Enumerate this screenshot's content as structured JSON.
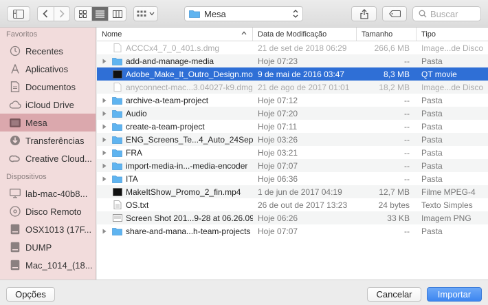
{
  "toolbar": {
    "location": "Mesa",
    "search_placeholder": "Buscar"
  },
  "colors": {
    "accent": "#2f6fd6",
    "sidebar_bg": "#f2dcdc",
    "sidebar_selected": "#dba8ad",
    "folder_blue": "#5fb4f0",
    "primary_button": "#3d86f0"
  },
  "sidebar": {
    "favorites_label": "Favoritos",
    "favorites": [
      {
        "label": "Recentes",
        "icon": "clock-icon"
      },
      {
        "label": "Aplicativos",
        "icon": "applications-icon"
      },
      {
        "label": "Documentos",
        "icon": "document-icon"
      },
      {
        "label": "iCloud Drive",
        "icon": "cloud-icon"
      },
      {
        "label": "Mesa",
        "icon": "desktop-icon",
        "selected": true
      },
      {
        "label": "Transferências",
        "icon": "download-icon"
      },
      {
        "label": "Creative Cloud...",
        "icon": "creative-cloud-icon"
      }
    ],
    "devices_label": "Dispositivos",
    "devices": [
      {
        "label": "lab-mac-40b8...",
        "icon": "computer-icon"
      },
      {
        "label": "Disco Remoto",
        "icon": "disc-icon"
      },
      {
        "label": "OSX1013 (17F...",
        "icon": "drive-icon"
      },
      {
        "label": "DUMP",
        "icon": "drive-icon"
      },
      {
        "label": "Mac_1014_(18...",
        "icon": "drive-icon"
      }
    ]
  },
  "columns": {
    "name": "Nome",
    "date": "Data de Modificação",
    "size": "Tamanho",
    "kind": "Tipo"
  },
  "files": [
    {
      "name": "ACCCx4_7_0_401.s.dmg",
      "date": "21 de set de 2018 06:29",
      "size": "266,6 MB",
      "kind": "Image...de Disco",
      "type": "dmg",
      "dim": true
    },
    {
      "name": "add-and-manage-media",
      "date": "Hoje 07:23",
      "size": "--",
      "kind": "Pasta",
      "type": "folder"
    },
    {
      "name": "Adobe_Make_It_Outro_Design.mov",
      "date": "9 de mai de 2016 03:47",
      "size": "8,3 MB",
      "kind": "QT movie",
      "type": "movie",
      "selected": true
    },
    {
      "name": "anyconnect-mac...3.04027-k9.dmg",
      "date": "21 de ago de 2017 01:01",
      "size": "18,2 MB",
      "kind": "Image...de Disco",
      "type": "dmg",
      "dim": true
    },
    {
      "name": "archive-a-team-project",
      "date": "Hoje 07:12",
      "size": "--",
      "kind": "Pasta",
      "type": "folder"
    },
    {
      "name": "Audio",
      "date": "Hoje 07:20",
      "size": "--",
      "kind": "Pasta",
      "type": "folder"
    },
    {
      "name": "create-a-team-project",
      "date": "Hoje 07:11",
      "size": "--",
      "kind": "Pasta",
      "type": "folder"
    },
    {
      "name": "ENG_Screens_Te...4_Auto_24Sep18",
      "date": "Hoje 03:26",
      "size": "--",
      "kind": "Pasta",
      "type": "folder"
    },
    {
      "name": "FRA",
      "date": "Hoje 03:21",
      "size": "--",
      "kind": "Pasta",
      "type": "folder"
    },
    {
      "name": "import-media-in...-media-encoder",
      "date": "Hoje 07:07",
      "size": "--",
      "kind": "Pasta",
      "type": "folder"
    },
    {
      "name": "ITA",
      "date": "Hoje 06:36",
      "size": "--",
      "kind": "Pasta",
      "type": "folder"
    },
    {
      "name": "MakeItShow_Promo_2_fin.mp4",
      "date": "1 de jun de 2017 04:19",
      "size": "12,7 MB",
      "kind": "Filme MPEG-4",
      "type": "movie"
    },
    {
      "name": "OS.txt",
      "date": "26 de out de 2017 13:23",
      "size": "24 bytes",
      "kind": "Texto Simples",
      "type": "text"
    },
    {
      "name": "Screen Shot 201...9-28 at 06.26.09",
      "date": "Hoje 06:26",
      "size": "33 KB",
      "kind": "Imagem PNG",
      "type": "image"
    },
    {
      "name": "share-and-mana...h-team-projects",
      "date": "Hoje 07:07",
      "size": "--",
      "kind": "Pasta",
      "type": "folder"
    }
  ],
  "buttons": {
    "options": "Opções",
    "cancel": "Cancelar",
    "import": "Importar"
  }
}
